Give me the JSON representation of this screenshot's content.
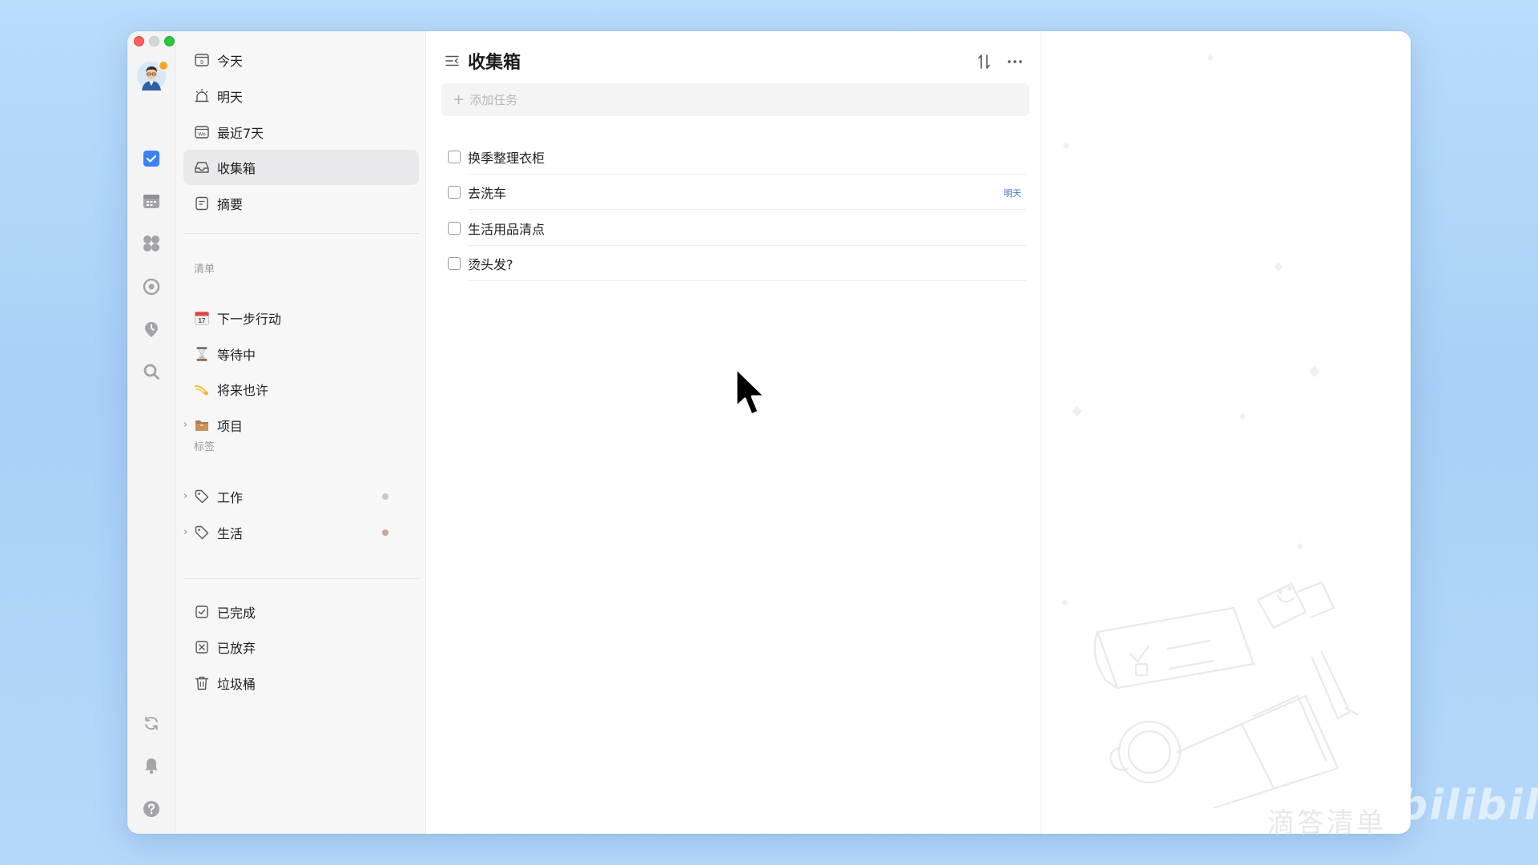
{
  "sidebar": {
    "smart_lists": [
      {
        "label": "今天",
        "icon": "calendar-day-icon",
        "day": "9"
      },
      {
        "label": "明天",
        "icon": "sunrise-icon"
      },
      {
        "label": "最近7天",
        "icon": "calendar-week-icon",
        "week_text": "We"
      },
      {
        "label": "收集箱",
        "icon": "inbox-icon",
        "active": true
      },
      {
        "label": "摘要",
        "icon": "summary-icon"
      }
    ],
    "lists_section_title": "清单",
    "lists": [
      {
        "label": "下一步行动",
        "icon": "calendar-emoji-icon",
        "emoji": "📅"
      },
      {
        "label": "等待中",
        "icon": "hourglass-emoji-icon",
        "emoji": "⏳"
      },
      {
        "label": "将来也许",
        "icon": "comet-emoji-icon",
        "emoji": "💫"
      },
      {
        "label": "项目",
        "icon": "folder-emoji-icon",
        "emoji": "📦"
      }
    ],
    "tags_section_title": "标签",
    "tags": [
      {
        "label": "工作",
        "dot_color": "#c8c8cc"
      },
      {
        "label": "生活",
        "dot_color": "#c9a59a"
      }
    ],
    "bottom_lists": [
      {
        "label": "已完成",
        "icon": "completed-icon"
      },
      {
        "label": "已放弃",
        "icon": "abandoned-icon"
      },
      {
        "label": "垃圾桶",
        "icon": "trash-icon"
      }
    ]
  },
  "main": {
    "title": "收集箱",
    "add_task_placeholder": "添加任务",
    "tasks": [
      {
        "title": "换季整理衣柜",
        "due": ""
      },
      {
        "title": "去洗车",
        "due": "明天"
      },
      {
        "title": "生活用品清点",
        "due": ""
      },
      {
        "title": "烫头发?",
        "due": ""
      }
    ]
  },
  "colors": {
    "accent": "#3b82f6",
    "due_text": "#3e73c9",
    "sidebar_bg": "#f7f7f8",
    "rail_bg": "#f4f4f5"
  },
  "watermark": {
    "app_name": "滴答清单",
    "site": "bilibili"
  }
}
